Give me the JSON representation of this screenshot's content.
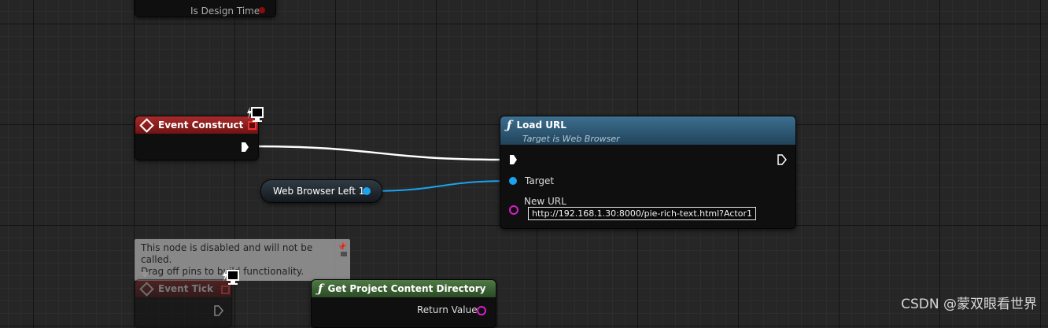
{
  "top_node": {
    "pin_label": "Is Design Time"
  },
  "event_construct": {
    "title": "Event Construct"
  },
  "load_url": {
    "title": "Load URL",
    "subtitle": "Target is Web Browser",
    "target_label": "Target",
    "new_url_label": "New URL",
    "new_url_value": "http://192.168.1.30:8000/pie-rich-text.html?Actor1"
  },
  "web_browser_var": {
    "label": "Web Browser Left 1"
  },
  "comment": {
    "line1": "This node is disabled and will not be called.",
    "line2": "Drag off pins to build functionality."
  },
  "event_tick": {
    "title": "Event Tick"
  },
  "get_project_content_dir": {
    "title": "Get Project Content Directory",
    "return_label": "Return Value"
  },
  "watermark": "CSDN @蒙双眼看世界",
  "colors": {
    "event_red": "#a82a2a",
    "function_blue": "#3c6f8f",
    "pure_green": "#4f7a44",
    "object_pin": "#1aa3ef",
    "string_pin": "#d61ec9"
  }
}
